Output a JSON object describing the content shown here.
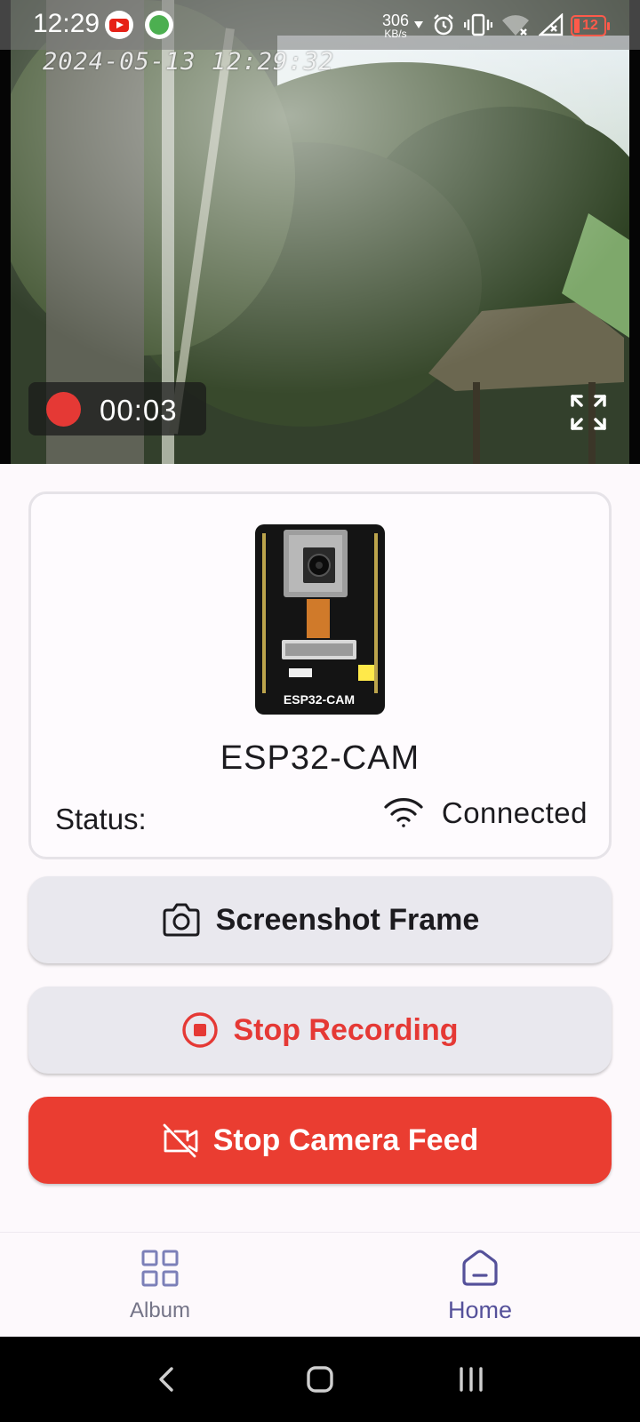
{
  "status_bar": {
    "time": "12:29",
    "net_speed_value": "306",
    "net_speed_unit": "KB/s",
    "battery_level": "12",
    "icons": [
      "youtube-icon",
      "app-notification-icon",
      "download-arrow-icon",
      "alarm-icon",
      "vibrate-icon",
      "wifi-off-icon",
      "signal-off-icon",
      "battery-icon"
    ]
  },
  "video_feed": {
    "timestamp_overlay": "2024-05-13 12:29:32",
    "recording": {
      "elapsed": "00:03"
    },
    "fullscreen_icon": "fullscreen-icon"
  },
  "device": {
    "name": "ESP32-CAM",
    "board_label": "ESP32-CAM",
    "status_label": "Status:",
    "status_value": "Connected",
    "status_icon": "wifi-icon"
  },
  "actions": {
    "screenshot_label": "Screenshot Frame",
    "stop_recording_label": "Stop Recording",
    "stop_feed_label": "Stop Camera Feed"
  },
  "bottom_nav": {
    "items": [
      {
        "label": "Album",
        "icon": "grid-icon",
        "active": false
      },
      {
        "label": "Home",
        "icon": "home-icon",
        "active": true
      }
    ]
  },
  "colors": {
    "primary_red": "#ea3d31",
    "record_red": "#e53935",
    "active_nav": "#55519a",
    "button_grey": "#e9e8ee"
  }
}
